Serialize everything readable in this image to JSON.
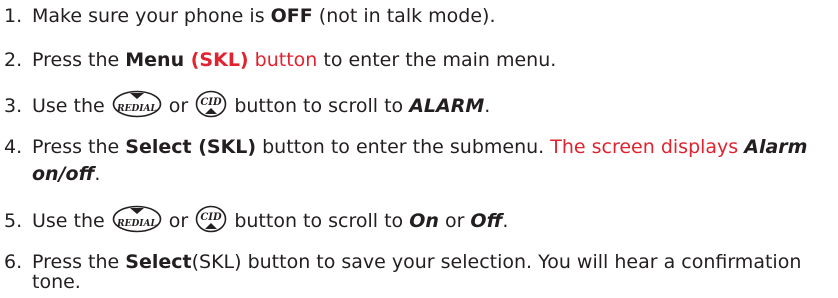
{
  "steps": [
    {
      "num": "1.",
      "t1": "Make sure your phone is ",
      "b1": "OFF",
      "t2": " (not in talk mode)."
    },
    {
      "num": "2.",
      "t1": "Press the ",
      "b1": "Menu ",
      "r1": "(SKL)",
      "r2": " button",
      "t2": " to enter the main menu."
    },
    {
      "num": "3.",
      "t1": "Use the ",
      "t2": " or ",
      "t3": " button to scroll to ",
      "bi1": "ALARM",
      "t4": "."
    },
    {
      "num": "4.",
      "t1": "Press the ",
      "b1": "Select (SKL)",
      "t2": " button to enter the submenu. ",
      "r1": "The screen displays ",
      "bi1": "Alarm",
      "bi2": "on/off",
      "t3": "."
    },
    {
      "num": "5.",
      "t1": "Use the ",
      "t2": " or ",
      "t3": " button to scroll to ",
      "bi1": "On",
      "t4": " or ",
      "bi2": "Off",
      "t5": "."
    },
    {
      "num": "6.",
      "t1": "Press the ",
      "b1": "Select",
      "t2": "(SKL) button to save your selection. You will hear a confirmation",
      "t3": "tone."
    }
  ],
  "icons": {
    "redial": {
      "name": "redial-down-button-icon",
      "text": "REDIAL"
    },
    "cid": {
      "name": "cid-up-button-icon",
      "text": "CID"
    }
  },
  "colors": {
    "text": "#231f20",
    "accent": "#e0232f"
  }
}
